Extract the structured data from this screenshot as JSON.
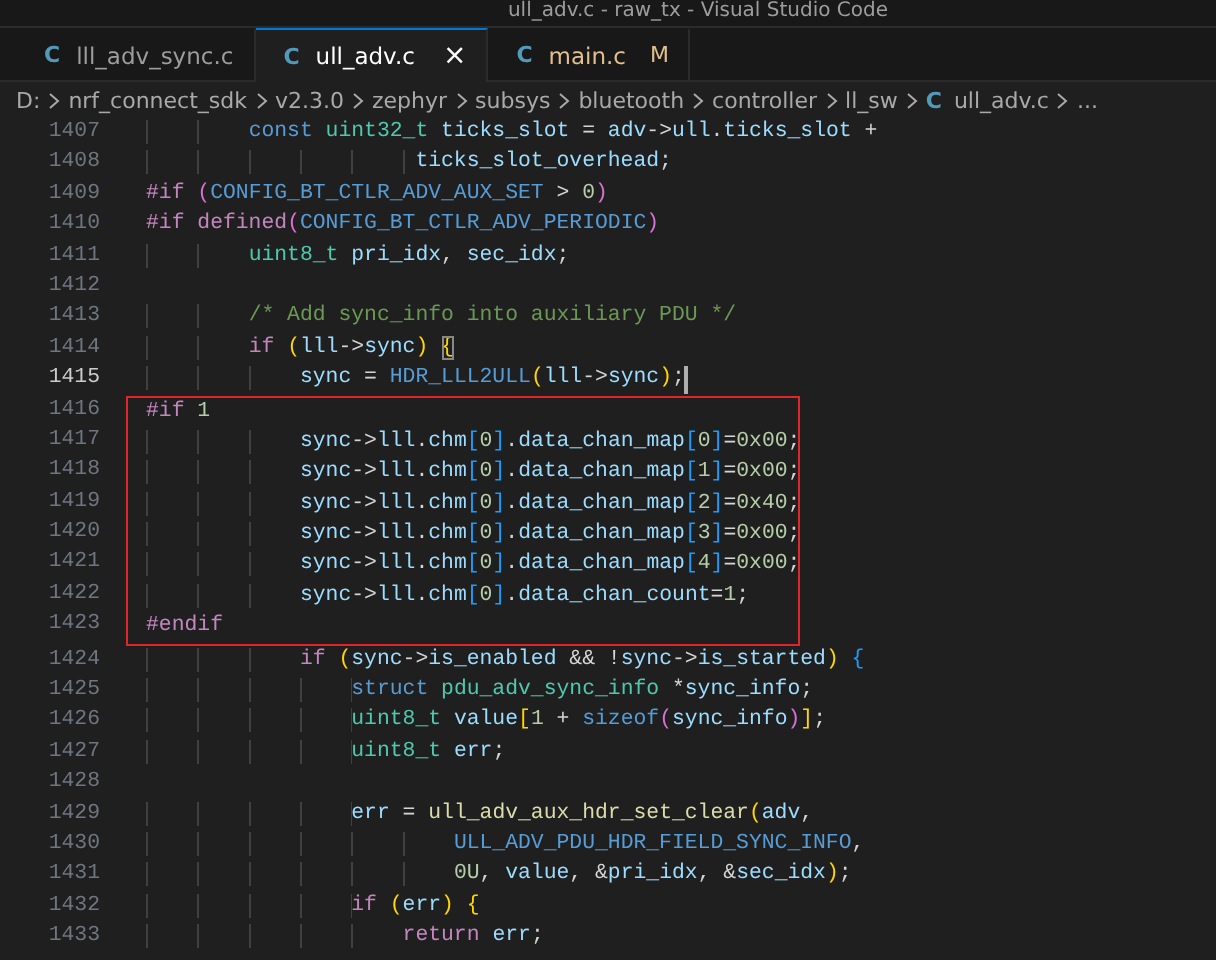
{
  "window": {
    "title": "ull_adv.c - raw_tx - Visual Studio Code"
  },
  "tabs": [
    {
      "icon": "C",
      "label": "lll_adv_sync.c",
      "selected": false,
      "modified": false
    },
    {
      "icon": "C",
      "label": "ull_adv.c",
      "selected": true,
      "modified": false,
      "close": "×"
    },
    {
      "icon": "C",
      "label": "main.c",
      "selected": false,
      "modified": true,
      "badge": "M"
    }
  ],
  "breadcrumb": [
    {
      "label": "D:"
    },
    {
      "label": "nrf_connect_sdk"
    },
    {
      "label": "v2.3.0"
    },
    {
      "label": "zephyr"
    },
    {
      "label": "subsys"
    },
    {
      "label": "bluetooth"
    },
    {
      "label": "controller"
    },
    {
      "label": "ll_sw"
    },
    {
      "icon": "C",
      "label": "ull_adv.c"
    },
    {
      "label": "..."
    }
  ],
  "editor": {
    "blocks": [
      {
        "kind": "plain",
        "lines": [
          {
            "number": "1407",
            "current": false,
            "code": [
              {
                "text": "        const ",
                "kind": "mac"
              },
              {
                "text": "uint32_t ",
                "kind": "type"
              },
              {
                "text": "ticks_slot",
                "kind": "var"
              },
              {
                "text": " = ",
                "kind": "p"
              },
              {
                "text": "adv",
                "kind": "var"
              },
              {
                "text": "->",
                "kind": "p"
              },
              {
                "text": "ull",
                "kind": "var"
              },
              {
                "text": ".",
                "kind": "p"
              },
              {
                "text": "ticks_slot",
                "kind": "var"
              },
              {
                "text": " +",
                "kind": "p"
              }
            ]
          },
          {
            "number": "1408",
            "current": false,
            "code": [
              {
                "text": "                     ticks_slot_overhead",
                "kind": "var"
              },
              {
                "text": ";",
                "kind": "p"
              }
            ]
          },
          {
            "number": "1409",
            "current": false,
            "code": [
              {
                "text": "#if ",
                "kind": "kw"
              },
              {
                "text": "(",
                "kind": "b2"
              },
              {
                "text": "CONFIG_BT_CTLR_ADV_AUX_SET",
                "kind": "mac"
              },
              {
                "text": " > ",
                "kind": "p"
              },
              {
                "text": "0",
                "kind": "num"
              },
              {
                "text": ")",
                "kind": "b2"
              }
            ]
          },
          {
            "number": "1410",
            "current": false,
            "code": [
              {
                "text": "#if ",
                "kind": "kw"
              },
              {
                "text": "defined",
                "kind": "kw"
              },
              {
                "text": "(",
                "kind": "b2"
              },
              {
                "text": "CONFIG_BT_CTLR_ADV_PERIODIC",
                "kind": "mac"
              },
              {
                "text": ")",
                "kind": "b2"
              }
            ]
          },
          {
            "number": "1411",
            "current": false,
            "code": [
              {
                "text": "        uint8_t ",
                "kind": "type"
              },
              {
                "text": "pri_idx",
                "kind": "var"
              },
              {
                "text": ", ",
                "kind": "p"
              },
              {
                "text": "sec_idx",
                "kind": "var"
              },
              {
                "text": ";",
                "kind": "p"
              }
            ]
          },
          {
            "number": "1412",
            "current": false
          },
          {
            "number": "1413",
            "current": false,
            "code": [
              {
                "text": "        /* Add sync_info into auxiliary PDU */",
                "kind": "com"
              }
            ]
          },
          {
            "number": "1414",
            "current": false,
            "code": [
              {
                "text": "        if ",
                "kind": "kw"
              },
              {
                "text": "(",
                "kind": "b1"
              },
              {
                "text": "lll",
                "kind": "var"
              },
              {
                "text": "->",
                "kind": "p"
              },
              {
                "text": "sync",
                "kind": "var"
              },
              {
                "text": ") ",
                "kind": "b1"
              },
              {
                "text": "{",
                "kind": "match"
              }
            ]
          },
          {
            "number": "1415",
            "current": true,
            "code": [
              {
                "text": "            sync",
                "kind": "var"
              },
              {
                "text": " = ",
                "kind": "p"
              },
              {
                "text": "HDR_LLL2ULL",
                "kind": "mac"
              },
              {
                "text": "(",
                "kind": "b1"
              },
              {
                "text": "lll",
                "kind": "var"
              },
              {
                "text": "->",
                "kind": "p"
              },
              {
                "text": "sync",
                "kind": "var"
              },
              {
                "text": ")",
                "kind": "b1"
              },
              {
                "text": ";",
                "kind": "p"
              }
            ]
          }
        ]
      },
      {
        "kind": "boxed",
        "lines": [
          {
            "number": "1416",
            "current": false,
            "code": [
              {
                "text": "#if ",
                "kind": "kw"
              },
              {
                "text": "1",
                "kind": "num"
              }
            ]
          },
          {
            "number": "1417",
            "current": false,
            "code": [
              {
                "text": "            sync",
                "kind": "var"
              },
              {
                "text": "->",
                "kind": "p"
              },
              {
                "text": "lll",
                "kind": "var"
              },
              {
                "text": ".",
                "kind": "p"
              },
              {
                "text": "chm",
                "kind": "var"
              },
              {
                "text": "[",
                "kind": "b3"
              },
              {
                "text": "0",
                "kind": "num"
              },
              {
                "text": "]",
                "kind": "b3"
              },
              {
                "text": ".",
                "kind": "p"
              },
              {
                "text": "data_chan_map",
                "kind": "var"
              },
              {
                "text": "[",
                "kind": "b3"
              },
              {
                "text": "0",
                "kind": "num"
              },
              {
                "text": "]",
                "kind": "b3"
              },
              {
                "text": "=",
                "kind": "p"
              },
              {
                "text": "0x00",
                "kind": "num"
              },
              {
                "text": ";",
                "kind": "p"
              }
            ]
          },
          {
            "number": "1418",
            "current": false,
            "code": [
              {
                "text": "            sync",
                "kind": "var"
              },
              {
                "text": "->",
                "kind": "p"
              },
              {
                "text": "lll",
                "kind": "var"
              },
              {
                "text": ".",
                "kind": "p"
              },
              {
                "text": "chm",
                "kind": "var"
              },
              {
                "text": "[",
                "kind": "b3"
              },
              {
                "text": "0",
                "kind": "num"
              },
              {
                "text": "]",
                "kind": "b3"
              },
              {
                "text": ".",
                "kind": "p"
              },
              {
                "text": "data_chan_map",
                "kind": "var"
              },
              {
                "text": "[",
                "kind": "b3"
              },
              {
                "text": "1",
                "kind": "num"
              },
              {
                "text": "]",
                "kind": "b3"
              },
              {
                "text": "=",
                "kind": "p"
              },
              {
                "text": "0x00",
                "kind": "num"
              },
              {
                "text": ";",
                "kind": "p"
              }
            ]
          },
          {
            "number": "1419",
            "current": false,
            "code": [
              {
                "text": "            sync",
                "kind": "var"
              },
              {
                "text": "->",
                "kind": "p"
              },
              {
                "text": "lll",
                "kind": "var"
              },
              {
                "text": ".",
                "kind": "p"
              },
              {
                "text": "chm",
                "kind": "var"
              },
              {
                "text": "[",
                "kind": "b3"
              },
              {
                "text": "0",
                "kind": "num"
              },
              {
                "text": "]",
                "kind": "b3"
              },
              {
                "text": ".",
                "kind": "p"
              },
              {
                "text": "data_chan_map",
                "kind": "var"
              },
              {
                "text": "[",
                "kind": "b3"
              },
              {
                "text": "2",
                "kind": "num"
              },
              {
                "text": "]",
                "kind": "b3"
              },
              {
                "text": "=",
                "kind": "p"
              },
              {
                "text": "0x40",
                "kind": "num"
              },
              {
                "text": ";",
                "kind": "p"
              }
            ]
          },
          {
            "number": "1420",
            "current": false,
            "code": [
              {
                "text": "            sync",
                "kind": "var"
              },
              {
                "text": "->",
                "kind": "p"
              },
              {
                "text": "lll",
                "kind": "var"
              },
              {
                "text": ".",
                "kind": "p"
              },
              {
                "text": "chm",
                "kind": "var"
              },
              {
                "text": "[",
                "kind": "b3"
              },
              {
                "text": "0",
                "kind": "num"
              },
              {
                "text": "]",
                "kind": "b3"
              },
              {
                "text": ".",
                "kind": "p"
              },
              {
                "text": "data_chan_map",
                "kind": "var"
              },
              {
                "text": "[",
                "kind": "b3"
              },
              {
                "text": "3",
                "kind": "num"
              },
              {
                "text": "]",
                "kind": "b3"
              },
              {
                "text": "=",
                "kind": "p"
              },
              {
                "text": "0x00",
                "kind": "num"
              },
              {
                "text": ";",
                "kind": "p"
              }
            ]
          },
          {
            "number": "1421",
            "current": false,
            "code": [
              {
                "text": "            sync",
                "kind": "var"
              },
              {
                "text": "->",
                "kind": "p"
              },
              {
                "text": "lll",
                "kind": "var"
              },
              {
                "text": ".",
                "kind": "p"
              },
              {
                "text": "chm",
                "kind": "var"
              },
              {
                "text": "[",
                "kind": "b3"
              },
              {
                "text": "0",
                "kind": "num"
              },
              {
                "text": "]",
                "kind": "b3"
              },
              {
                "text": ".",
                "kind": "p"
              },
              {
                "text": "data_chan_map",
                "kind": "var"
              },
              {
                "text": "[",
                "kind": "b3"
              },
              {
                "text": "4",
                "kind": "num"
              },
              {
                "text": "]",
                "kind": "b3"
              },
              {
                "text": "=",
                "kind": "p"
              },
              {
                "text": "0x00",
                "kind": "num"
              },
              {
                "text": ";",
                "kind": "p"
              }
            ]
          },
          {
            "number": "1422",
            "current": false,
            "code": [
              {
                "text": "            sync",
                "kind": "var"
              },
              {
                "text": "->",
                "kind": "p"
              },
              {
                "text": "lll",
                "kind": "var"
              },
              {
                "text": ".",
                "kind": "p"
              },
              {
                "text": "chm",
                "kind": "var"
              },
              {
                "text": "[",
                "kind": "b3"
              },
              {
                "text": "0",
                "kind": "num"
              },
              {
                "text": "]",
                "kind": "b3"
              },
              {
                "text": ".",
                "kind": "p"
              },
              {
                "text": "data_chan_count",
                "kind": "var"
              },
              {
                "text": "=",
                "kind": "p"
              },
              {
                "text": "1",
                "kind": "num"
              },
              {
                "text": ";",
                "kind": "p"
              }
            ]
          },
          {
            "number": "1423",
            "current": false,
            "code": [
              {
                "text": "#endif",
                "kind": "kw"
              }
            ]
          }
        ]
      },
      {
        "kind": "plain",
        "lines": [
          {
            "number": "1424",
            "current": false,
            "code": [
              {
                "text": "            if ",
                "kind": "kw"
              },
              {
                "text": "(",
                "kind": "b1"
              },
              {
                "text": "sync",
                "kind": "var"
              },
              {
                "text": "->",
                "kind": "p"
              },
              {
                "text": "is_enabled",
                "kind": "var"
              },
              {
                "text": " && !",
                "kind": "p"
              },
              {
                "text": "sync",
                "kind": "var"
              },
              {
                "text": "->",
                "kind": "p"
              },
              {
                "text": "is_started",
                "kind": "var"
              },
              {
                "text": ") ",
                "kind": "b1"
              },
              {
                "text": "{",
                "kind": "b3"
              }
            ]
          },
          {
            "number": "1425",
            "current": false,
            "code": [
              {
                "text": "                struct ",
                "kind": "mac"
              },
              {
                "text": "pdu_adv_sync_info",
                "kind": "type"
              },
              {
                "text": " *",
                "kind": "p"
              },
              {
                "text": "sync_info",
                "kind": "var"
              },
              {
                "text": ";",
                "kind": "p"
              }
            ]
          },
          {
            "number": "1426",
            "current": false,
            "code": [
              {
                "text": "                uint8_t ",
                "kind": "type"
              },
              {
                "text": "value",
                "kind": "var"
              },
              {
                "text": "[",
                "kind": "b1"
              },
              {
                "text": "1",
                "kind": "num"
              },
              {
                "text": " + ",
                "kind": "p"
              },
              {
                "text": "sizeof",
                "kind": "mac"
              },
              {
                "text": "(",
                "kind": "b2"
              },
              {
                "text": "sync_info",
                "kind": "var"
              },
              {
                "text": ")",
                "kind": "b2"
              },
              {
                "text": "]",
                "kind": "b1"
              },
              {
                "text": ";",
                "kind": "p"
              }
            ]
          },
          {
            "number": "1427",
            "current": false,
            "code": [
              {
                "text": "                uint8_t ",
                "kind": "type"
              },
              {
                "text": "err",
                "kind": "var"
              },
              {
                "text": ";",
                "kind": "p"
              }
            ]
          },
          {
            "number": "1428",
            "current": false
          },
          {
            "number": "1429",
            "current": false,
            "code": [
              {
                "text": "                err",
                "kind": "var"
              },
              {
                "text": " = ",
                "kind": "p"
              },
              {
                "text": "ull_adv_aux_hdr_set_clear",
                "kind": "fn"
              },
              {
                "text": "(",
                "kind": "b1"
              },
              {
                "text": "adv",
                "kind": "var"
              },
              {
                "text": ",",
                "kind": "p"
              }
            ]
          },
          {
            "number": "1430",
            "current": false,
            "code": [
              {
                "text": "                        ULL_ADV_PDU_HDR_FIELD_SYNC_INFO",
                "kind": "mac"
              },
              {
                "text": ",",
                "kind": "p"
              }
            ]
          },
          {
            "number": "1431",
            "current": false,
            "code": [
              {
                "text": "                        0U",
                "kind": "num"
              },
              {
                "text": ", ",
                "kind": "p"
              },
              {
                "text": "value",
                "kind": "var"
              },
              {
                "text": ", &",
                "kind": "p"
              },
              {
                "text": "pri_idx",
                "kind": "var"
              },
              {
                "text": ", &",
                "kind": "p"
              },
              {
                "text": "sec_idx",
                "kind": "var"
              },
              {
                "text": ")",
                "kind": "b1"
              },
              {
                "text": ";",
                "kind": "p"
              }
            ]
          },
          {
            "number": "1432",
            "current": false,
            "code": [
              {
                "text": "                if ",
                "kind": "kw"
              },
              {
                "text": "(",
                "kind": "b1"
              },
              {
                "text": "err",
                "kind": "var"
              },
              {
                "text": ") ",
                "kind": "b1"
              },
              {
                "text": "{",
                "kind": "b1"
              }
            ]
          },
          {
            "number": "1433",
            "current": false,
            "code": [
              {
                "text": "                    return ",
                "kind": "kw"
              },
              {
                "text": "err",
                "kind": "var"
              },
              {
                "text": ";",
                "kind": "p"
              }
            ]
          }
        ]
      }
    ]
  }
}
